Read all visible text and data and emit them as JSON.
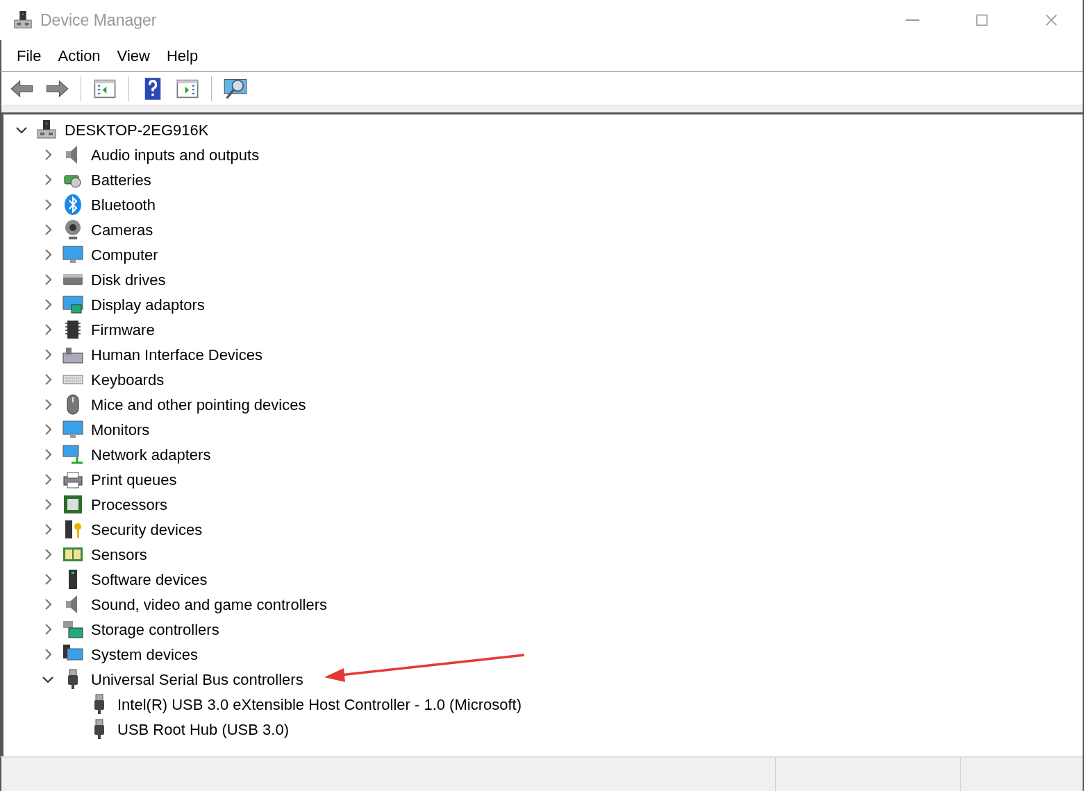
{
  "window": {
    "title": "Device Manager"
  },
  "menu": [
    "File",
    "Action",
    "View",
    "Help"
  ],
  "tree": [
    {
      "label": "DESKTOP-2EG916K",
      "expanded": true,
      "children": [
        {
          "label": "Audio inputs and outputs",
          "expanded": false
        },
        {
          "label": "Batteries",
          "expanded": false
        },
        {
          "label": "Bluetooth",
          "expanded": false
        },
        {
          "label": "Cameras",
          "expanded": false
        },
        {
          "label": "Computer",
          "expanded": false
        },
        {
          "label": "Disk drives",
          "expanded": false
        },
        {
          "label": "Display adaptors",
          "expanded": false
        },
        {
          "label": "Firmware",
          "expanded": false
        },
        {
          "label": "Human Interface Devices",
          "expanded": false
        },
        {
          "label": "Keyboards",
          "expanded": false
        },
        {
          "label": "Mice and other pointing devices",
          "expanded": false
        },
        {
          "label": "Monitors",
          "expanded": false
        },
        {
          "label": "Network adapters",
          "expanded": false
        },
        {
          "label": "Print queues",
          "expanded": false
        },
        {
          "label": "Processors",
          "expanded": false
        },
        {
          "label": "Security devices",
          "expanded": false
        },
        {
          "label": "Sensors",
          "expanded": false
        },
        {
          "label": "Software devices",
          "expanded": false
        },
        {
          "label": "Sound, video and game controllers",
          "expanded": false
        },
        {
          "label": "Storage controllers",
          "expanded": false
        },
        {
          "label": "System devices",
          "expanded": false
        },
        {
          "label": "Universal Serial Bus controllers",
          "expanded": true,
          "children": [
            {
              "label": "Intel(R) USB 3.0 eXtensible Host Controller - 1.0 (Microsoft)"
            },
            {
              "label": "USB Root Hub (USB 3.0)"
            }
          ]
        }
      ]
    }
  ]
}
